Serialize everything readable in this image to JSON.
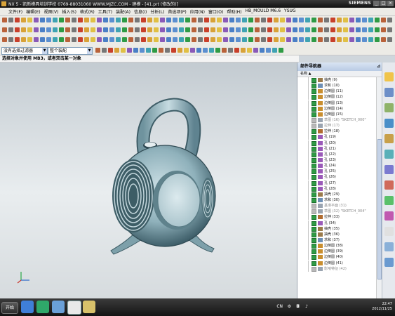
{
  "window": {
    "title": "NX 5 - 凯新模具培训学校 0769-88031060 WWW.MJZC.COM - 建模 - [41.prt (修改的)]",
    "brand": "SIEMENS"
  },
  "menu": [
    "文件(F)",
    "编辑(E)",
    "视图(V)",
    "插入(S)",
    "格式(R)",
    "工具(T)",
    "装配(A)",
    "信息(I)",
    "分析(L)",
    "首选项(P)",
    "应用(N)",
    "窗口(O)",
    "帮助(H)",
    "HB_MOULD M6.6",
    "YSUG"
  ],
  "selection": {
    "filter": "没有选择过滤器",
    "scope": "整个装配"
  },
  "status_text": "选择对象并使用 MB3，或者双击某一对象",
  "part_navigator": {
    "title": "部件导航器",
    "column_name": "名称",
    "features": [
      {
        "label": "抽壳 (9)",
        "dim": false,
        "color": "#9a7a4a"
      },
      {
        "label": "求和 (10)",
        "dim": false,
        "color": "#6d8fb5"
      },
      {
        "label": "边倒圆 (11)",
        "dim": false,
        "color": "#c98e2f"
      },
      {
        "label": "边倒圆 (12)",
        "dim": false,
        "color": "#c98e2f"
      },
      {
        "label": "边倒圆 (13)",
        "dim": false,
        "color": "#c98e2f"
      },
      {
        "label": "边倒圆 (14)",
        "dim": false,
        "color": "#c98e2f"
      },
      {
        "label": "边倒圆 (15)",
        "dim": false,
        "color": "#c98e2f"
      },
      {
        "label": "草图 (16) \"SKETCH_000\"",
        "dim": true,
        "color": "#9aa4b0"
      },
      {
        "label": "拉伸 (17)",
        "dim": true,
        "color": "#9aa4b0"
      },
      {
        "label": "拉伸 (18)",
        "dim": false,
        "color": "#b06b2f"
      },
      {
        "label": "孔 (19)",
        "dim": false,
        "color": "#9a5ab8"
      },
      {
        "label": "孔 (20)",
        "dim": false,
        "color": "#9a5ab8"
      },
      {
        "label": "孔 (21)",
        "dim": false,
        "color": "#9a5ab8"
      },
      {
        "label": "孔 (22)",
        "dim": false,
        "color": "#9a5ab8"
      },
      {
        "label": "孔 (23)",
        "dim": false,
        "color": "#9a5ab8"
      },
      {
        "label": "孔 (24)",
        "dim": false,
        "color": "#9a5ab8"
      },
      {
        "label": "孔 (25)",
        "dim": false,
        "color": "#9a5ab8"
      },
      {
        "label": "孔 (26)",
        "dim": false,
        "color": "#9a5ab8"
      },
      {
        "label": "孔 (27)",
        "dim": false,
        "color": "#9a5ab8"
      },
      {
        "label": "孔 (28)",
        "dim": false,
        "color": "#9a5ab8"
      },
      {
        "label": "抽壳 (29)",
        "dim": false,
        "color": "#9a7a4a"
      },
      {
        "label": "求和 (30)",
        "dim": false,
        "color": "#6d8fb5"
      },
      {
        "label": "基准平面 (31)",
        "dim": true,
        "color": "#9aa4b0"
      },
      {
        "label": "草图 (32) \"SKETCH_004\"",
        "dim": true,
        "color": "#9aa4b0"
      },
      {
        "label": "拉伸 (33)",
        "dim": false,
        "color": "#b06b2f"
      },
      {
        "label": "孔 (34)",
        "dim": false,
        "color": "#9a5ab8"
      },
      {
        "label": "抽壳 (35)",
        "dim": false,
        "color": "#9a7a4a"
      },
      {
        "label": "抽壳 (36)",
        "dim": false,
        "color": "#9a7a4a"
      },
      {
        "label": "求和 (37)",
        "dim": false,
        "color": "#6d8fb5"
      },
      {
        "label": "边倒圆 (38)",
        "dim": false,
        "color": "#c98e2f"
      },
      {
        "label": "边倒圆 (39)",
        "dim": false,
        "color": "#c98e2f"
      },
      {
        "label": "边倒圆 (40)",
        "dim": false,
        "color": "#c98e2f"
      },
      {
        "label": "边倒圆 (41)",
        "dim": false,
        "color": "#c98e2f"
      },
      {
        "label": "影响特征 (42)",
        "dim": true,
        "color": "#9aa4b0"
      }
    ]
  },
  "taskbar": {
    "start_label": "开始",
    "input_lang": "CN",
    "time": "22:47",
    "date": "2012/11/25"
  }
}
